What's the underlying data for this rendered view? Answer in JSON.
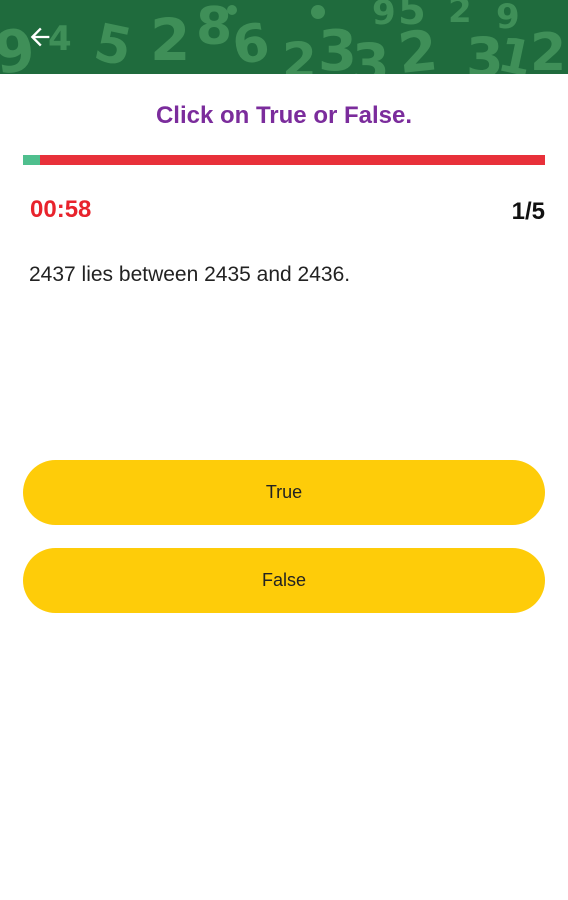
{
  "header": {
    "back_icon": "arrow-left-icon",
    "bg_color": "#1f6b3d",
    "pattern_color": "#3f8f58"
  },
  "quiz": {
    "instruction": "Click on True or False.",
    "progress_fraction": 0.033,
    "timer": "00:58",
    "counter": "1/5",
    "question": "2437 lies between 2435 and 2436.",
    "answers": [
      {
        "label": "True"
      },
      {
        "label": "False"
      }
    ]
  },
  "colors": {
    "title": "#7b2c9c",
    "timer": "#e8232c",
    "progress_remaining": "#e8303a",
    "progress_done": "#4fbf8e",
    "answer_button": "#fecc09"
  }
}
